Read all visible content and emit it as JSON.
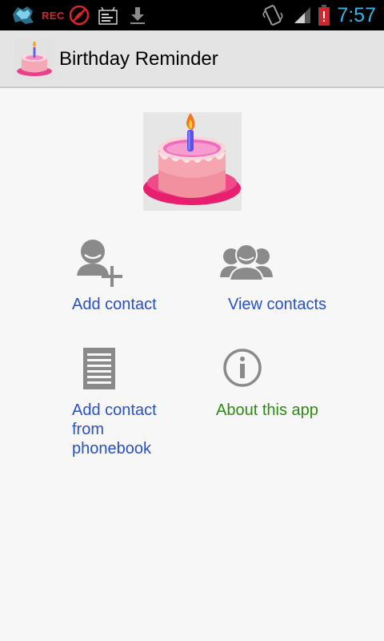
{
  "status_bar": {
    "rec_label": "REC",
    "time": "7:57",
    "time_color": "#34b5e5"
  },
  "action_bar": {
    "title": "Birthday Reminder",
    "icon": "birthday-cake-icon"
  },
  "hero": {
    "icon": "birthday-cake-candle-icon"
  },
  "menu": {
    "add_contact": {
      "label": "Add contact",
      "icon": "add-person-icon"
    },
    "view_contacts": {
      "label": "View contacts",
      "icon": "group-icon"
    },
    "add_from_phonebook": {
      "label": "Add contact from phonebook",
      "icon": "document-list-icon"
    },
    "about": {
      "label": "About this app",
      "icon": "info-icon"
    }
  },
  "colors": {
    "link_blue": "#2850c8",
    "link_green": "#2e8b12",
    "icon_gray": "#8a8a8a"
  }
}
